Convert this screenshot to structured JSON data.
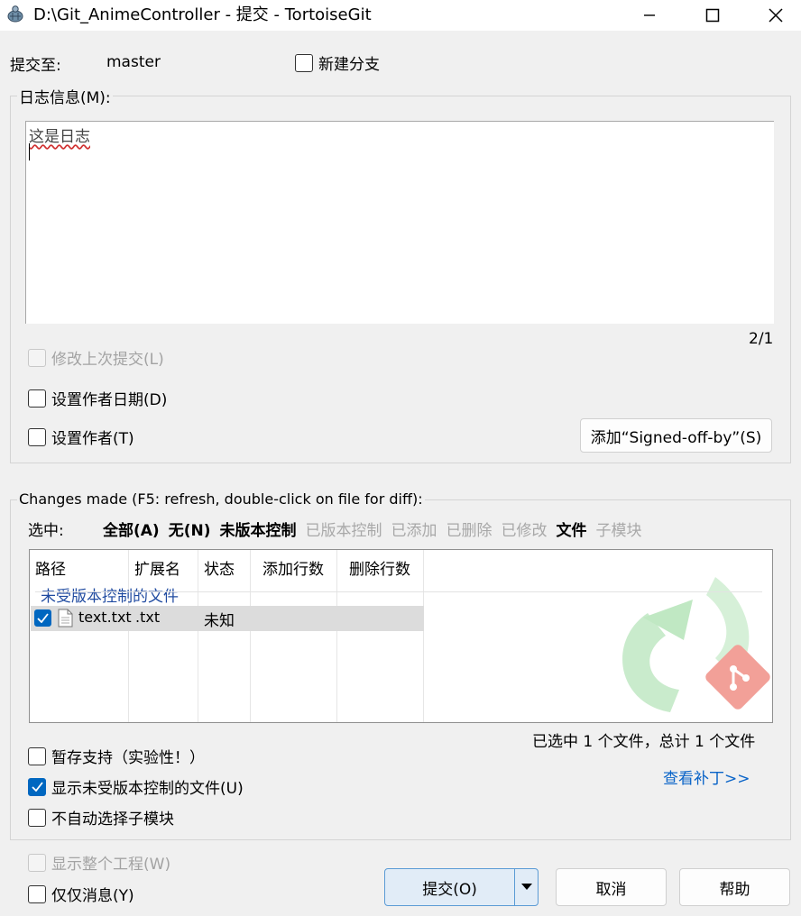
{
  "window": {
    "title": "D:\\Git_AnimeController - 提交 - TortoiseGit",
    "minimize_icon": "minimize-icon",
    "maximize_icon": "maximize-icon",
    "close_icon": "close-icon"
  },
  "commit_to": {
    "label": "提交至:",
    "branch": "master",
    "new_branch_label": "新建分支",
    "new_branch_checked": false
  },
  "log": {
    "group_label": "日志信息(M):",
    "message": "这是日志",
    "counter": "2/1",
    "amend_label": "修改上次提交(L)",
    "amend_enabled": false,
    "set_date_label": "设置作者日期(D)",
    "set_author_label": "设置作者(T)",
    "signed_off_label": "添加“Signed-off-by”(S)"
  },
  "changes": {
    "group_label": "Changes made (F5: refresh, double-click on file for diff):",
    "select_label": "选中:",
    "filters": [
      {
        "label": "全部(A)",
        "style": "bold"
      },
      {
        "label": "无(N)",
        "style": "bold"
      },
      {
        "label": "未版本控制",
        "style": "bold"
      },
      {
        "label": "已版本控制",
        "style": "dim"
      },
      {
        "label": "已添加",
        "style": "dim"
      },
      {
        "label": "已删除",
        "style": "dim"
      },
      {
        "label": "已修改",
        "style": "dim"
      },
      {
        "label": "文件",
        "style": "bold"
      },
      {
        "label": "子模块",
        "style": "dim"
      }
    ],
    "columns": [
      "路径",
      "扩展名",
      "状态",
      "添加行数",
      "删除行数"
    ],
    "group_row": "未受版本控制的文件",
    "rows": [
      {
        "checked": true,
        "icon": "file-icon",
        "path": "text.txt",
        "ext": ".txt",
        "status": "未知",
        "added": "",
        "deleted": ""
      }
    ],
    "selection_summary": "已选中 1 个文件，总计 1 个文件",
    "stash_label": "暂存支持（实验性！）",
    "show_unversioned_label": "显示未受版本控制的文件(U)",
    "show_unversioned_checked": true,
    "no_autoselect_sub_label": "不自动选择子模块",
    "view_patch_label": "查看补丁>>"
  },
  "footer": {
    "show_whole_project_label": "显示整个工程(W)",
    "show_whole_project_enabled": false,
    "message_only_label": "仅仅消息(Y)",
    "commit_label": "提交(O)",
    "cancel_label": "取消",
    "help_label": "帮助"
  },
  "colors": {
    "accent": "#0067c0",
    "link": "#0a64c8",
    "group_row_text": "#1f4aa0",
    "selected_row_bg": "#dcdcdc",
    "watermark_green": "#3cb44b",
    "watermark_red": "#e8473b"
  }
}
